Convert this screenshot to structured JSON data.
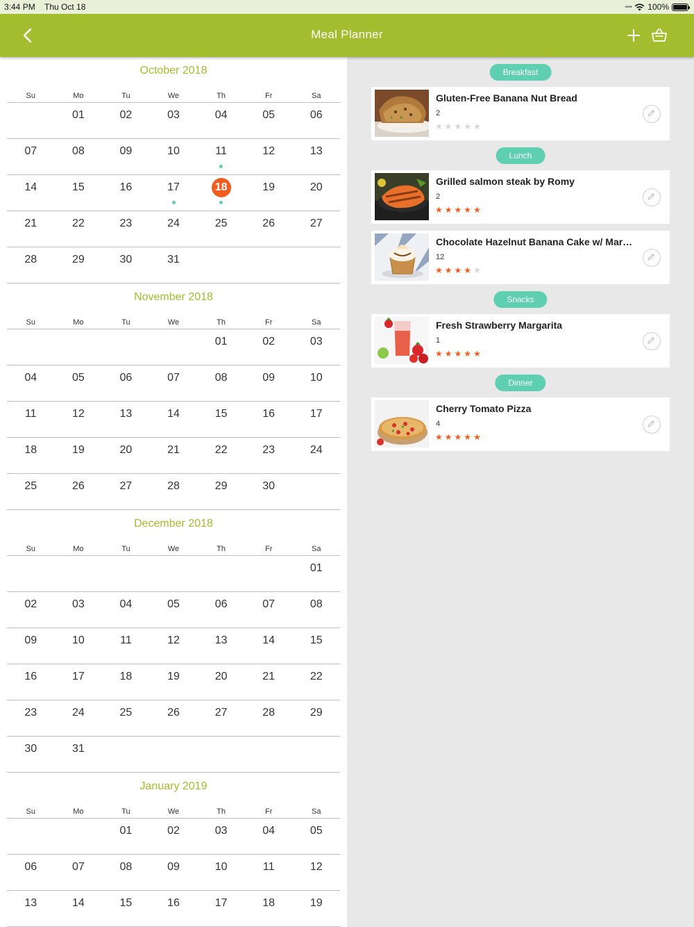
{
  "status": {
    "time": "3:44 PM",
    "date": "Thu Oct 18",
    "battery": "100%"
  },
  "nav": {
    "title": "Meal Planner"
  },
  "weekdays": [
    "Su",
    "Mo",
    "Tu",
    "We",
    "Th",
    "Fr",
    "Sa"
  ],
  "months": [
    {
      "title": "October 2018",
      "weeks": [
        [
          "",
          "01",
          "02",
          "03",
          "04",
          "05",
          "06"
        ],
        [
          "07",
          "08",
          "09",
          "10",
          "11",
          "12",
          "13"
        ],
        [
          "14",
          "15",
          "16",
          "17",
          "18",
          "19",
          "20"
        ],
        [
          "21",
          "22",
          "23",
          "24",
          "25",
          "26",
          "27"
        ],
        [
          "28",
          "29",
          "30",
          "31",
          "",
          "",
          ""
        ]
      ],
      "today": "18",
      "marked": [
        "11",
        "17",
        "18"
      ]
    },
    {
      "title": "November 2018",
      "weeks": [
        [
          "",
          "",
          "",
          "",
          "01",
          "02",
          "03"
        ],
        [
          "04",
          "05",
          "06",
          "07",
          "08",
          "09",
          "10"
        ],
        [
          "11",
          "12",
          "13",
          "14",
          "15",
          "16",
          "17"
        ],
        [
          "18",
          "19",
          "20",
          "21",
          "22",
          "23",
          "24"
        ],
        [
          "25",
          "26",
          "27",
          "28",
          "29",
          "30",
          ""
        ]
      ],
      "today": "",
      "marked": []
    },
    {
      "title": "December 2018",
      "weeks": [
        [
          "",
          "",
          "",
          "",
          "",
          "",
          "01"
        ],
        [
          "02",
          "03",
          "04",
          "05",
          "06",
          "07",
          "08"
        ],
        [
          "09",
          "10",
          "11",
          "12",
          "13",
          "14",
          "15"
        ],
        [
          "16",
          "17",
          "18",
          "19",
          "20",
          "21",
          "22"
        ],
        [
          "23",
          "24",
          "25",
          "26",
          "27",
          "28",
          "29"
        ],
        [
          "30",
          "31",
          "",
          "",
          "",
          "",
          ""
        ]
      ],
      "today": "",
      "marked": []
    },
    {
      "title": "January 2019",
      "weeks": [
        [
          "",
          "",
          "01",
          "02",
          "03",
          "04",
          "05"
        ],
        [
          "06",
          "07",
          "08",
          "09",
          "10",
          "11",
          "12"
        ],
        [
          "13",
          "14",
          "15",
          "16",
          "17",
          "18",
          "19"
        ]
      ],
      "today": "",
      "marked": []
    }
  ],
  "meal_sections": [
    {
      "label": "Breakfast",
      "items": [
        {
          "name": "Gluten-Free Banana Nut Bread",
          "count": "2",
          "rating": 0,
          "image": "banana-bread"
        }
      ]
    },
    {
      "label": "Lunch",
      "items": [
        {
          "name": "Grilled salmon steak by Romy",
          "count": "2",
          "rating": 5,
          "image": "salmon"
        },
        {
          "name": "Chocolate Hazelnut Banana Cake w/ Mar…",
          "count": "12",
          "rating": 4,
          "image": "cake"
        }
      ]
    },
    {
      "label": "Snacks",
      "items": [
        {
          "name": "Fresh Strawberry Margarita",
          "count": "1",
          "rating": 5,
          "image": "margarita"
        }
      ]
    },
    {
      "label": "Dinner",
      "items": [
        {
          "name": "Cherry Tomato Pizza",
          "count": "4",
          "rating": 5,
          "image": "pizza"
        }
      ]
    }
  ],
  "colors": {
    "nav": "#a3bd2e",
    "accent": "#f25c1f",
    "tag": "#5ecfb0",
    "month_title": "#a3bd2e"
  }
}
